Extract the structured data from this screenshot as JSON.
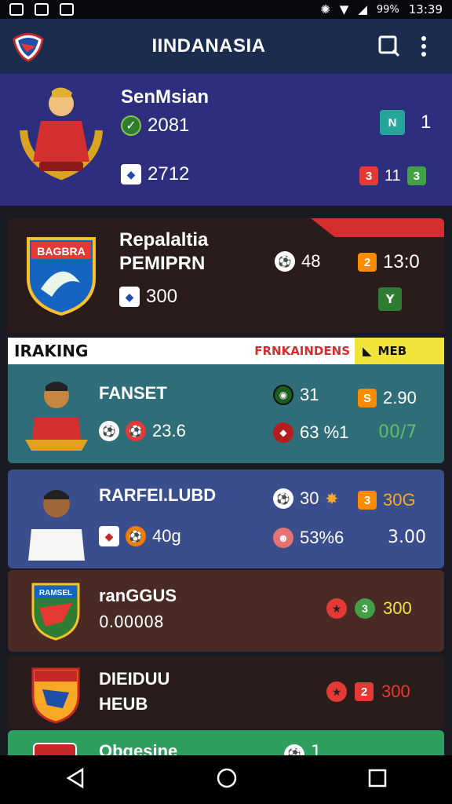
{
  "status": {
    "battery": "99%",
    "time": "13:39"
  },
  "app": {
    "title": "IINDANASIA"
  },
  "featured": {
    "name": "SenMsian",
    "stat1": "2081",
    "stat2": "2712",
    "badge_n": "N",
    "count1": "1",
    "red_badge": "3",
    "count2": "11",
    "green_badge": "3"
  },
  "club": {
    "name1": "Repalaltia",
    "name2": "PEMIPRN",
    "stat": "300",
    "shield_text": "BAGBRA",
    "ball_val": "48",
    "badge_val": "2",
    "score": "13:0",
    "green": "Y"
  },
  "ranking": {
    "label": "IRAKING",
    "mid": "FRNKAINDENS",
    "right": "MEB"
  },
  "players": [
    {
      "name": "FANSET",
      "stat": "23.6",
      "v1": "31",
      "b1": "S",
      "v2": "2.90",
      "v3": "63 %1",
      "v4": "00/7"
    },
    {
      "name": "RARFEI.LUBD",
      "stat": "40g",
      "v1": "30",
      "b1": "3",
      "v2": "30G",
      "v3": "53%6",
      "v4": "3.00"
    }
  ],
  "clubs": [
    {
      "name": "ranGGUS",
      "sub": "0.00008",
      "shield": "RAMSEL",
      "badge": "3",
      "value": "300"
    },
    {
      "name": "DIEIDUU",
      "sub": "HEUB",
      "badge": "2",
      "value": "300"
    },
    {
      "name": "Obgesine",
      "value": "1"
    }
  ]
}
